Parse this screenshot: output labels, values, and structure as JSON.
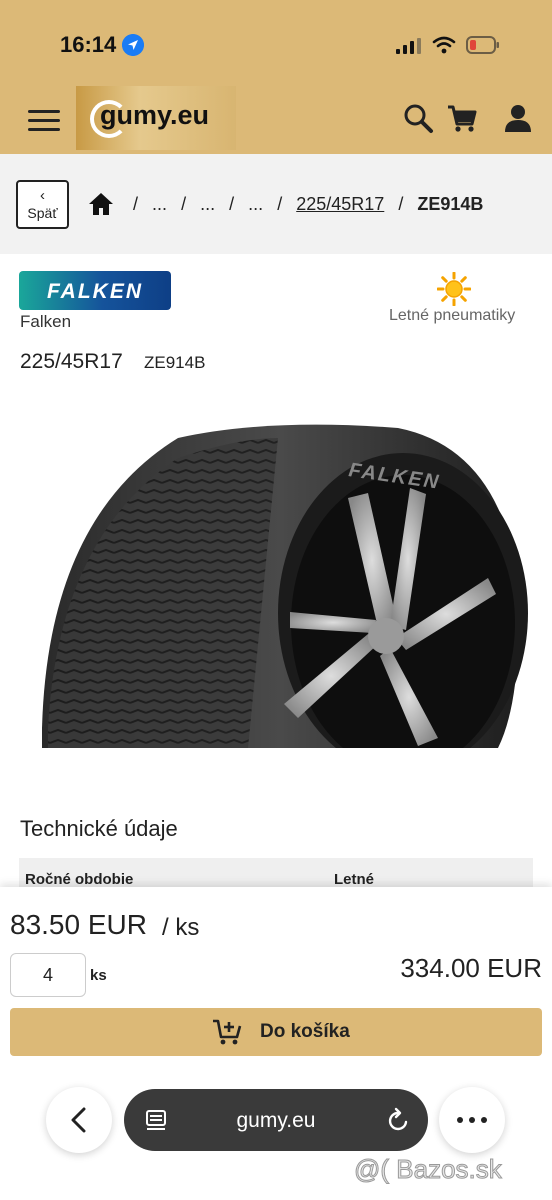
{
  "status": {
    "time": "16:14"
  },
  "header": {
    "logo_text": "gumy.eu"
  },
  "breadcrumb": {
    "back_label": "Späť",
    "items": [
      "...",
      "...",
      "...",
      "225/45R17",
      "ZE914B"
    ]
  },
  "product": {
    "brand_logo_text": "FALKEN",
    "brand": "Falken",
    "season": "Letné pneumatiky",
    "size": "225/45R17",
    "model": "ZE914B",
    "image_brand_text": "FALKEN"
  },
  "tech": {
    "title": "Technické údaje",
    "rows": [
      {
        "key": "Ročné obdobie",
        "value": "Letné"
      }
    ]
  },
  "purchase": {
    "price": "83.50 EUR",
    "unit": "/ ks",
    "quantity": "4",
    "qty_unit": "ks",
    "total": "334.00 EUR",
    "add_to_cart": "Do košíka"
  },
  "browser": {
    "url": "gumy.eu"
  },
  "watermark": "@( Bazos.sk",
  "colors": {
    "accent": "#dcb977",
    "brand_badge": "#15539b",
    "location": "#1a7cf5"
  },
  "icons": [
    "location-icon",
    "signal-icon",
    "wifi-icon",
    "battery-icon",
    "menu-icon",
    "search-icon",
    "cart-icon",
    "user-icon",
    "home-icon",
    "sun-icon",
    "add-to-cart-icon",
    "back-arrow-icon",
    "tabs-icon",
    "reload-icon",
    "more-icon"
  ]
}
